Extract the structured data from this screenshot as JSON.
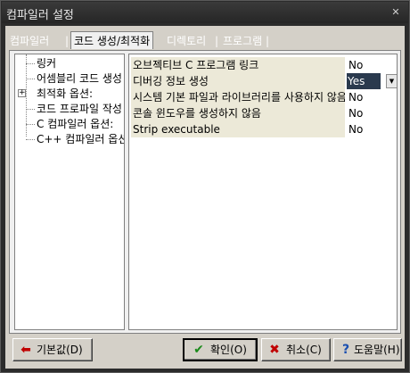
{
  "window": {
    "title": "컴파일러 설정"
  },
  "tabs": [
    {
      "label": "컴파일러",
      "active": false
    },
    {
      "label": "코드 생성/최적화",
      "active": true
    },
    {
      "label": "디렉토리",
      "active": false
    },
    {
      "label": "프로그램",
      "active": false
    }
  ],
  "tab_separators": [
    "|",
    "|",
    "|"
  ],
  "tree": {
    "items": [
      {
        "label": "링커",
        "expandable": false
      },
      {
        "label": "어셈블리 코드 생성",
        "expandable": false
      },
      {
        "label": "최적화 옵션:",
        "expandable": true,
        "expander": "+"
      },
      {
        "label": "코드 프로파일 작성",
        "expandable": false
      },
      {
        "label": "C 컴파일러 옵션:",
        "expandable": false
      },
      {
        "label": "C++ 컴파일러 옵션",
        "expandable": false
      }
    ]
  },
  "properties": [
    {
      "name": "오브젝티브 C 프로그램 링크",
      "value": "No",
      "selected": false
    },
    {
      "name": "디버깅 정보 생성",
      "value": "Yes",
      "selected": true
    },
    {
      "name": "시스템 기본 파일과 라이브러리를 사용하지 않음",
      "value": "No",
      "selected": false
    },
    {
      "name": "콘솔 윈도우를 생성하지 않음",
      "value": "No",
      "selected": false
    },
    {
      "name": "Strip executable",
      "value": "No",
      "selected": false
    }
  ],
  "buttons": {
    "defaults": {
      "label": "기본값(D)",
      "icon": "red-arrow-left-icon",
      "color": "#c00000"
    },
    "ok": {
      "label": "확인(O)",
      "icon": "green-check-icon",
      "color": "#1a8a1a"
    },
    "cancel": {
      "label": "취소(C)",
      "icon": "red-x-icon",
      "color": "#c00000"
    },
    "help": {
      "label": "도움말(H)",
      "icon": "blue-question-icon",
      "color": "#1a4fb0"
    }
  },
  "icons": {
    "close": "close-icon",
    "dropdown": "dropdown-arrow-icon"
  },
  "colors": {
    "panel": "#d4d0c8",
    "name_cell": "#ece9d8",
    "selected_value": "#2a3a4e"
  }
}
